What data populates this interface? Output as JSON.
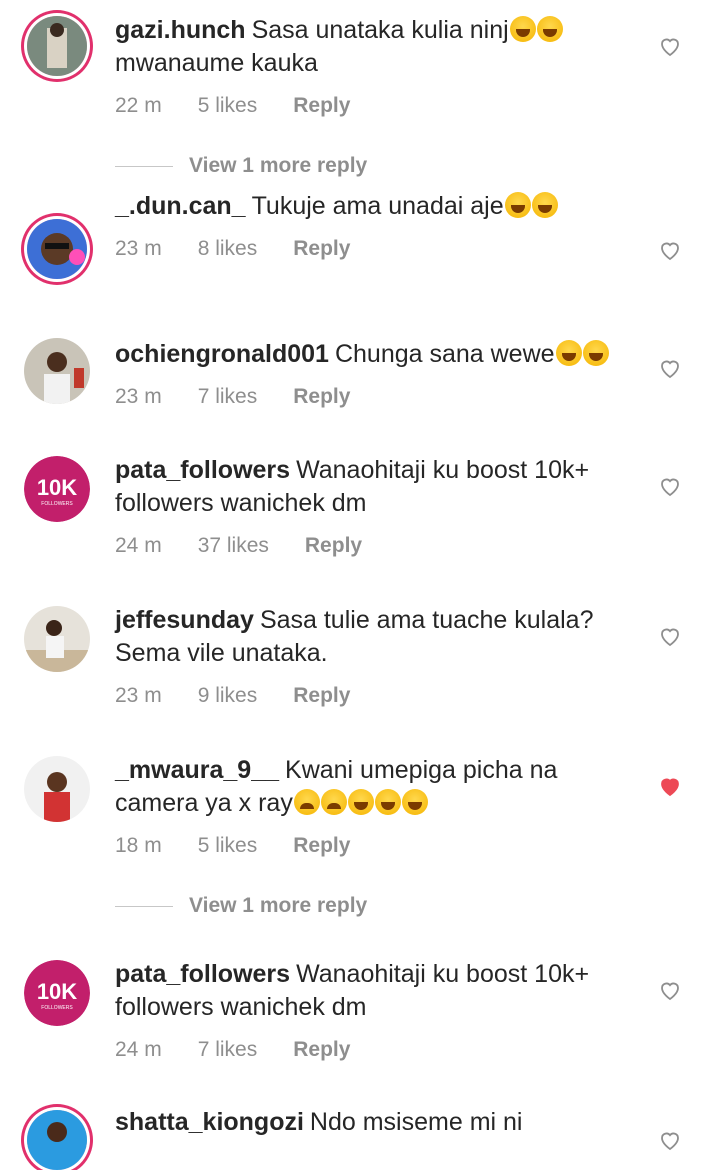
{
  "comments": [
    {
      "username": "gazi.hunch",
      "text": "Sasa unataka kulia ninj",
      "emojis": [
        "laugh",
        "laugh"
      ],
      "text2": "mwanaume kauka",
      "time": "22 m",
      "likes": "5 likes",
      "reply": "Reply",
      "liked": false
    },
    {
      "username": "_.dun.can_",
      "text": "Tukuje ama unadai aje",
      "emojis": [
        "laugh",
        "laugh"
      ],
      "text2": "",
      "time": "23 m",
      "likes": "8 likes",
      "reply": "Reply",
      "liked": false
    },
    {
      "username": "ochiengronald001",
      "text": "Chunga sana wewe",
      "emojis": [
        "laugh",
        "laugh"
      ],
      "text2": "",
      "time": "23 m",
      "likes": "7 likes",
      "reply": "Reply",
      "liked": false
    },
    {
      "username": "pata_followers",
      "text": "Wanaohitaji ku boost 10k+",
      "emojis": [],
      "text2": "followers wanichek dm",
      "time": "24 m",
      "likes": "37 likes",
      "reply": "Reply",
      "liked": false
    },
    {
      "username": "jeffesunday",
      "text": "Sasa tulie ama tuache kulala?",
      "emojis": [],
      "text2": "Sema vile unataka.",
      "time": "23 m",
      "likes": "9 likes",
      "reply": "Reply",
      "liked": false
    },
    {
      "username": "_mwaura_9__",
      "text": "Kwani umepiga picha na",
      "emojis": [],
      "text2": "camera ya x ray",
      "time": "18 m",
      "likes": "5 likes",
      "reply": "Reply",
      "liked": true
    },
    {
      "username": "pata_followers",
      "text": "Wanaohitaji ku boost 10k+",
      "emojis": [],
      "text2": "followers wanichek dm",
      "time": "24 m",
      "likes": "7 likes",
      "reply": "Reply",
      "liked": false
    },
    {
      "username": "shatta_kiongozi",
      "text": "Ndo msiseme mi ni",
      "emojis": [],
      "text2": "",
      "time": "",
      "likes": "",
      "reply": "",
      "liked": false
    }
  ],
  "view_more": [
    "View 1 more reply",
    "View 1 more reply"
  ],
  "avatar_badge": {
    "big": "10K",
    "small": "FOLLOWERS"
  },
  "colors": {
    "heart_liked": "#ed4956",
    "heart_outline": "#8e8e8e",
    "badge": "#c21f6b",
    "ring": "#e1306c"
  }
}
